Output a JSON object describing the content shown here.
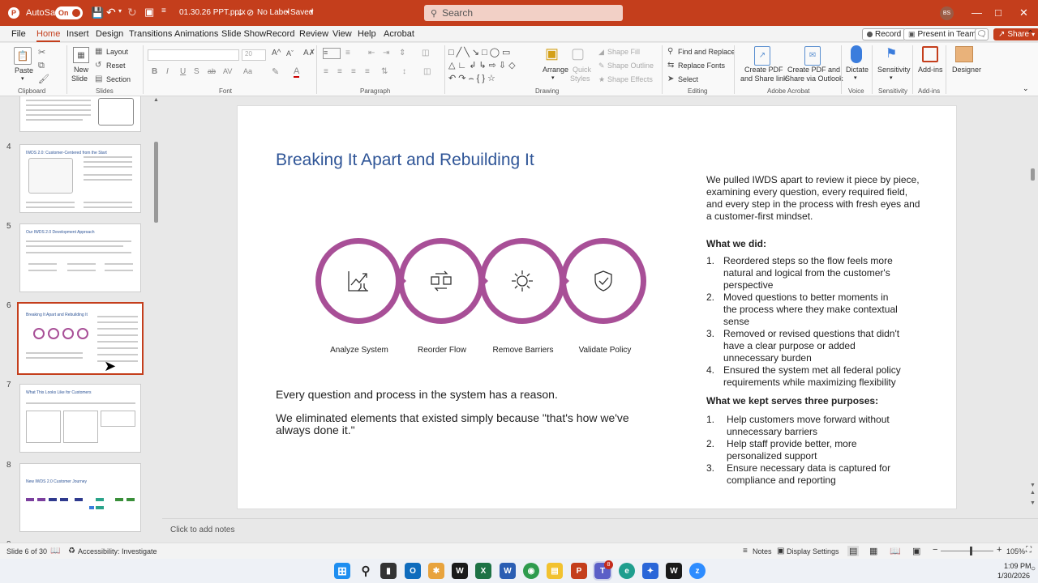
{
  "titlebar": {
    "autosave_label": "AutoSave",
    "autosave_state": "On",
    "filename": "01.30.26 PPT.pptx",
    "label_status": "No Label",
    "save_status": "Saved",
    "search_placeholder": "Search",
    "user_initials": "BS"
  },
  "menu": {
    "items": [
      "File",
      "Home",
      "Insert",
      "Design",
      "Transitions",
      "Animations",
      "Slide Show",
      "Record",
      "Review",
      "View",
      "Help",
      "Acrobat"
    ],
    "active": "Home",
    "record_btn": "Record",
    "present_btn": "Present in Teams",
    "share_btn": "Share"
  },
  "ribbon": {
    "clipboard": {
      "paste": "Paste",
      "label": "Clipboard"
    },
    "slides": {
      "new_slide": "New",
      "new_slide2": "Slide",
      "layout": "Layout",
      "reset": "Reset",
      "section": "Section",
      "label": "Slides"
    },
    "font": {
      "font_size": "20",
      "label": "Font"
    },
    "paragraph": {
      "label": "Paragraph"
    },
    "drawing": {
      "arrange": "Arrange",
      "quick_styles": "Quick",
      "quick_styles2": "Styles",
      "shape_fill": "Shape Fill",
      "shape_outline": "Shape Outline",
      "shape_effects": "Shape Effects",
      "label": "Drawing"
    },
    "editing": {
      "find_replace": "Find and Replace",
      "replace_fonts": "Replace Fonts",
      "select": "Select",
      "label": "Editing"
    },
    "acrobat": {
      "create_pdf": "Create PDF",
      "create_pdf2": "and Share link",
      "create_pdf_outlook": "Create PDF and",
      "create_pdf_outlook2": "Share via Outlook",
      "label": "Adobe Acrobat"
    },
    "voice": {
      "dictate": "Dictate",
      "label": "Voice"
    },
    "sensitivity": {
      "btn": "Sensitivity",
      "label": "Sensitivity"
    },
    "addins": {
      "btn": "Add-ins",
      "label": "Add-ins"
    },
    "designer": {
      "btn": "Designer"
    }
  },
  "thumbnails": [
    {
      "num": "4",
      "title": "IWDS 2.0: Customer-Centered from the Start"
    },
    {
      "num": "5",
      "title": "Our IWDS 2.0 Development Approach"
    },
    {
      "num": "6",
      "title": "Breaking It Apart and Rebuilding It"
    },
    {
      "num": "7",
      "title": "What This Looks Like for Customers"
    },
    {
      "num": "8",
      "title": "New IWDS 2.0 Customer Journey"
    }
  ],
  "slide": {
    "title": "Breaking It Apart and Rebuilding It",
    "steps": [
      "Analyze System",
      "Reorder Flow",
      "Remove Barriers",
      "Validate Policy"
    ],
    "step_icons": [
      "chart-flask-icon",
      "reorder-arrows-icon",
      "sun-icon",
      "shield-check-icon"
    ],
    "accent_color": "#a84f97",
    "title_color": "#2f5597",
    "body1": "Every question and process in the system has a reason.",
    "body2": "We eliminated elements that existed simply because \"that's how we've always done it.\"",
    "intro": "We pulled IWDS apart to review it piece by piece, examining every question, every required field, and every step in the process with fresh eyes and a customer-first mindset.",
    "did_heading": "What we did:",
    "did_items": [
      {
        "n": "1.",
        "lines": [
          "Reordered steps so the flow feels more",
          "natural and logical from the customer's",
          "perspective"
        ]
      },
      {
        "n": "2.",
        "lines": [
          "Moved questions to better moments in",
          "the process where they make contextual",
          "sense"
        ]
      },
      {
        "n": "3.",
        "lines": [
          "Removed or revised questions that didn't",
          "have a clear purpose or added",
          "unnecessary burden"
        ]
      },
      {
        "n": "4.",
        "lines": [
          "Ensured the system met all federal policy",
          "requirements while maximizing flexibility"
        ]
      }
    ],
    "kept_heading": "What we kept serves three purposes:",
    "kept_items": [
      {
        "n": "1.",
        "lines": [
          "Help customers move forward without",
          "unnecessary barriers"
        ]
      },
      {
        "n": "2.",
        "lines": [
          "Help staff provide better, more",
          "personalized support"
        ]
      },
      {
        "n": "3.",
        "lines": [
          "Ensure necessary data is captured for",
          "compliance and reporting"
        ]
      }
    ]
  },
  "notes_placeholder": "Click to add notes",
  "status": {
    "slide_count": "Slide 6 of 30",
    "accessibility": "Accessibility: Investigate",
    "notes": "Notes",
    "display_settings": "Display Settings",
    "zoom": "105%",
    "zoom_fraction": 0.55
  },
  "taskbar": {
    "time": "1:09 PM",
    "date": "1/30/2026",
    "teams_badge": "8"
  }
}
